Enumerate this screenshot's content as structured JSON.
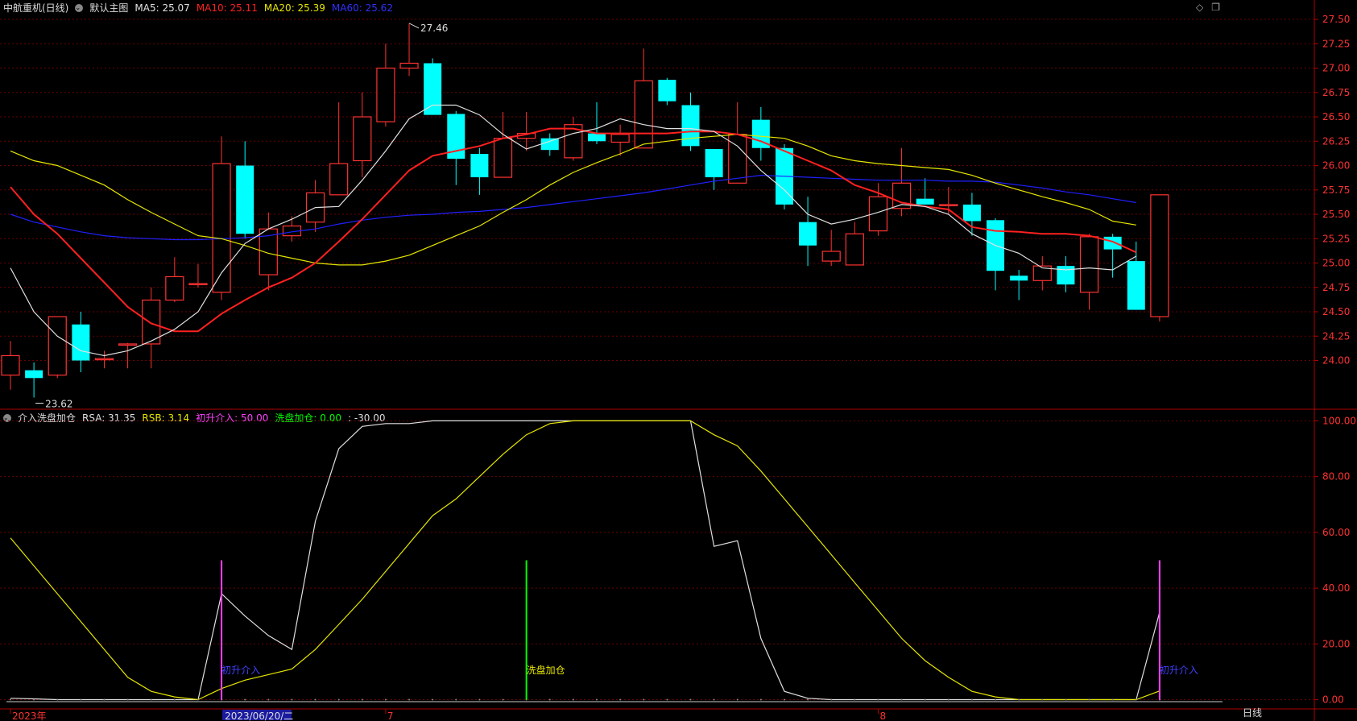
{
  "main_header": {
    "stock_name": "中航重机(日线)",
    "chart_mode": "默认主图",
    "ma5": "MA5: 25.07",
    "ma10": "MA10: 25.11",
    "ma20": "MA20: 25.39",
    "ma60": "MA60: 25.62"
  },
  "sub_header": {
    "indicator_name": "介入洗盘加仓",
    "rsa": "RSA: 31.35",
    "rsb": "RSB: 3.14",
    "entry": "初升介入: 50.00",
    "wash": "洗盘加仓: 0.00",
    "extra": ": -30.00"
  },
  "colors": {
    "up": "#ff3232",
    "down": "#00ffff",
    "ma5": "#e0e0e0",
    "ma10": "#ff2020",
    "ma20": "#e6e600",
    "ma60": "#2020ff",
    "grid": "#6a0000",
    "axis_text": "#ff3232",
    "entry_color": "#ff40ff",
    "wash_color": "#00ff00"
  },
  "timeframe_label": "日线",
  "chart_data": [
    {
      "type": "candlestick",
      "y_ticks": [
        "27.50",
        "27.25",
        "27.00",
        "26.75",
        "26.50",
        "26.25",
        "26.00",
        "25.75",
        "25.50",
        "25.25",
        "25.00",
        "24.75",
        "24.50",
        "24.25",
        "24.00"
      ],
      "ylim": [
        23.5,
        27.55
      ],
      "high_label": "27.46",
      "low_label": "23.62",
      "candles": [
        {
          "o": 23.85,
          "c": 24.05,
          "h": 24.2,
          "l": 23.7
        },
        {
          "o": 23.9,
          "c": 23.82,
          "h": 23.98,
          "l": 23.62
        },
        {
          "o": 23.85,
          "c": 24.45,
          "h": 24.45,
          "l": 23.82
        },
        {
          "o": 24.37,
          "c": 24.0,
          "h": 24.5,
          "l": 23.88
        },
        {
          "o": 24.02,
          "c": 24.02,
          "h": 24.1,
          "l": 23.92
        },
        {
          "o": 24.17,
          "c": 24.17,
          "h": 24.18,
          "l": 23.92
        },
        {
          "o": 24.17,
          "c": 24.62,
          "h": 24.75,
          "l": 23.92
        },
        {
          "o": 24.62,
          "c": 24.86,
          "h": 25.06,
          "l": 24.6
        },
        {
          "o": 24.79,
          "c": 24.79,
          "h": 24.99,
          "l": 24.75
        },
        {
          "o": 24.7,
          "c": 26.02,
          "h": 26.3,
          "l": 24.62
        },
        {
          "o": 26.0,
          "c": 25.3,
          "h": 26.25,
          "l": 25.25
        },
        {
          "o": 24.88,
          "c": 25.35,
          "h": 25.52,
          "l": 24.72
        },
        {
          "o": 25.28,
          "c": 25.38,
          "h": 25.48,
          "l": 25.22
        },
        {
          "o": 25.42,
          "c": 25.72,
          "h": 25.85,
          "l": 25.32
        },
        {
          "o": 25.7,
          "c": 26.02,
          "h": 26.65,
          "l": 25.7
        },
        {
          "o": 26.05,
          "c": 26.5,
          "h": 26.75,
          "l": 25.88
        },
        {
          "o": 26.45,
          "c": 27.0,
          "h": 27.25,
          "l": 26.4
        },
        {
          "o": 27.0,
          "c": 27.05,
          "h": 27.46,
          "l": 26.92
        },
        {
          "o": 27.05,
          "c": 26.52,
          "h": 27.1,
          "l": 26.52
        },
        {
          "o": 26.53,
          "c": 26.07,
          "h": 26.56,
          "l": 25.8
        },
        {
          "o": 26.12,
          "c": 25.88,
          "h": 26.18,
          "l": 25.7
        },
        {
          "o": 25.88,
          "c": 26.28,
          "h": 26.55,
          "l": 25.88
        },
        {
          "o": 26.28,
          "c": 26.33,
          "h": 26.55,
          "l": 26.15
        },
        {
          "o": 26.28,
          "c": 26.16,
          "h": 26.33,
          "l": 26.1
        },
        {
          "o": 26.08,
          "c": 26.42,
          "h": 26.5,
          "l": 26.05
        },
        {
          "o": 26.33,
          "c": 26.25,
          "h": 26.65,
          "l": 26.22
        },
        {
          "o": 26.24,
          "c": 26.32,
          "h": 26.42,
          "l": 26.1
        },
        {
          "o": 26.18,
          "c": 26.87,
          "h": 27.2,
          "l": 26.18
        },
        {
          "o": 26.88,
          "c": 26.66,
          "h": 26.9,
          "l": 26.62
        },
        {
          "o": 26.62,
          "c": 26.2,
          "h": 26.75,
          "l": 26.15
        },
        {
          "o": 26.17,
          "c": 25.88,
          "h": 26.17,
          "l": 25.75
        },
        {
          "o": 25.82,
          "c": 26.32,
          "h": 26.65,
          "l": 25.82
        },
        {
          "o": 26.47,
          "c": 26.18,
          "h": 26.6,
          "l": 26.05
        },
        {
          "o": 26.18,
          "c": 25.6,
          "h": 26.22,
          "l": 25.55
        },
        {
          "o": 25.42,
          "c": 25.18,
          "h": 25.68,
          "l": 24.97
        },
        {
          "o": 25.02,
          "c": 25.12,
          "h": 25.34,
          "l": 24.97
        },
        {
          "o": 24.98,
          "c": 25.3,
          "h": 25.42,
          "l": 24.98
        },
        {
          "o": 25.33,
          "c": 25.68,
          "h": 25.82,
          "l": 25.28
        },
        {
          "o": 25.56,
          "c": 25.82,
          "h": 26.18,
          "l": 25.48
        },
        {
          "o": 25.66,
          "c": 25.6,
          "h": 25.87,
          "l": 25.6
        },
        {
          "o": 25.6,
          "c": 25.6,
          "h": 25.78,
          "l": 25.5
        },
        {
          "o": 25.6,
          "c": 25.43,
          "h": 25.72,
          "l": 25.28
        },
        {
          "o": 25.44,
          "c": 24.92,
          "h": 25.46,
          "l": 24.72
        },
        {
          "o": 24.87,
          "c": 24.82,
          "h": 24.93,
          "l": 24.62
        },
        {
          "o": 24.82,
          "c": 24.97,
          "h": 25.07,
          "l": 24.72
        },
        {
          "o": 24.97,
          "c": 24.78,
          "h": 25.07,
          "l": 24.7
        },
        {
          "o": 24.7,
          "c": 25.27,
          "h": 25.3,
          "l": 24.52
        },
        {
          "o": 25.27,
          "c": 25.14,
          "h": 25.3,
          "l": 24.85
        },
        {
          "o": 25.02,
          "c": 24.52,
          "h": 25.22,
          "l": 24.52
        },
        {
          "o": 24.45,
          "c": 25.7,
          "h": 25.7,
          "l": 24.4
        }
      ],
      "ma5": [
        24.95,
        24.5,
        24.25,
        24.1,
        24.05,
        24.1,
        24.2,
        24.32,
        24.5,
        24.9,
        25.2,
        25.35,
        25.45,
        25.57,
        25.58,
        25.85,
        26.15,
        26.48,
        26.62,
        26.62,
        26.52,
        26.32,
        26.17,
        26.25,
        26.33,
        26.38,
        26.48,
        26.42,
        26.38,
        26.38,
        26.35,
        26.2,
        25.95,
        25.75,
        25.5,
        25.4,
        25.45,
        25.52,
        25.6,
        25.58,
        25.5,
        25.3,
        25.18,
        25.1,
        24.95,
        24.93,
        24.95,
        24.93,
        25.07
      ],
      "ma10": [
        25.78,
        25.5,
        25.3,
        25.05,
        24.8,
        24.55,
        24.38,
        24.3,
        24.3,
        24.48,
        24.62,
        24.75,
        24.85,
        25.0,
        25.22,
        25.45,
        25.7,
        25.95,
        26.1,
        26.15,
        26.2,
        26.28,
        26.32,
        26.38,
        26.38,
        26.33,
        26.33,
        26.33,
        26.33,
        26.35,
        26.35,
        26.32,
        26.25,
        26.15,
        26.05,
        25.95,
        25.8,
        25.72,
        25.62,
        25.58,
        25.55,
        25.37,
        25.33,
        25.32,
        25.3,
        25.3,
        25.28,
        25.22,
        25.11
      ],
      "ma20": [
        26.15,
        26.05,
        26.0,
        25.9,
        25.8,
        25.65,
        25.52,
        25.4,
        25.28,
        25.25,
        25.18,
        25.1,
        25.05,
        25.0,
        24.98,
        24.98,
        25.02,
        25.08,
        25.18,
        25.28,
        25.38,
        25.52,
        25.65,
        25.8,
        25.93,
        26.03,
        26.12,
        26.22,
        26.25,
        26.28,
        26.3,
        26.32,
        26.3,
        26.28,
        26.2,
        26.1,
        26.05,
        26.02,
        26.0,
        25.98,
        25.96,
        25.9,
        25.82,
        25.75,
        25.68,
        25.62,
        25.55,
        25.43,
        25.39
      ],
      "ma60": [
        25.5,
        25.42,
        25.37,
        25.32,
        25.28,
        25.26,
        25.25,
        25.24,
        25.24,
        25.25,
        25.26,
        25.28,
        25.32,
        25.35,
        25.4,
        25.44,
        25.47,
        25.49,
        25.5,
        25.52,
        25.53,
        25.55,
        25.57,
        25.6,
        25.63,
        25.66,
        25.69,
        25.72,
        25.76,
        25.8,
        25.84,
        25.87,
        25.9,
        25.89,
        25.88,
        25.87,
        25.86,
        25.85,
        25.85,
        25.85,
        25.84,
        25.84,
        25.83,
        25.8,
        25.77,
        25.73,
        25.7,
        25.66,
        25.62
      ]
    },
    {
      "type": "line",
      "y_ticks": [
        "100.00",
        "80.00",
        "60.00",
        "40.00",
        "20.00",
        "0.00"
      ],
      "ylim": [
        -1,
        103
      ],
      "series": [
        {
          "name": "RSA",
          "values": [
            0.5,
            0.3,
            0,
            0,
            0,
            0,
            0,
            0,
            0,
            38,
            30,
            23,
            18,
            64,
            90,
            98,
            99,
            99,
            100,
            100,
            100,
            100,
            100,
            100,
            100,
            100,
            100,
            100,
            100,
            100,
            55,
            57,
            22,
            3,
            0.5,
            0,
            0,
            0,
            0,
            0,
            0,
            0,
            0,
            0,
            0,
            0,
            0,
            0,
            0,
            31.35
          ]
        },
        {
          "name": "RSB",
          "values": [
            58,
            48,
            38,
            28,
            18,
            8,
            3,
            1,
            0,
            4,
            7,
            9,
            11,
            18,
            27,
            36,
            46,
            56,
            66,
            72,
            80,
            88,
            95,
            99,
            100,
            100,
            100,
            100,
            100,
            100,
            95,
            91,
            82,
            72,
            62,
            52,
            42,
            32,
            22,
            14,
            8,
            3,
            1,
            0,
            0,
            0,
            0,
            0,
            0,
            3.14
          ]
        }
      ],
      "signals": [
        {
          "label": "初升介入",
          "kind": "entry",
          "index": 9,
          "value": 50
        },
        {
          "label": "洗盘加仓",
          "kind": "wash",
          "index": 22,
          "value": 50
        },
        {
          "label": "初升介入",
          "kind": "entry",
          "index": 49,
          "value": 50
        }
      ]
    }
  ],
  "x_axis": {
    "labels": [
      {
        "text": "2023年",
        "index": 0
      },
      {
        "text": "2023/06/20/二",
        "index": 9,
        "highlight": true
      },
      {
        "text": "7",
        "index": 16
      },
      {
        "text": "8",
        "index": 37
      }
    ]
  }
}
